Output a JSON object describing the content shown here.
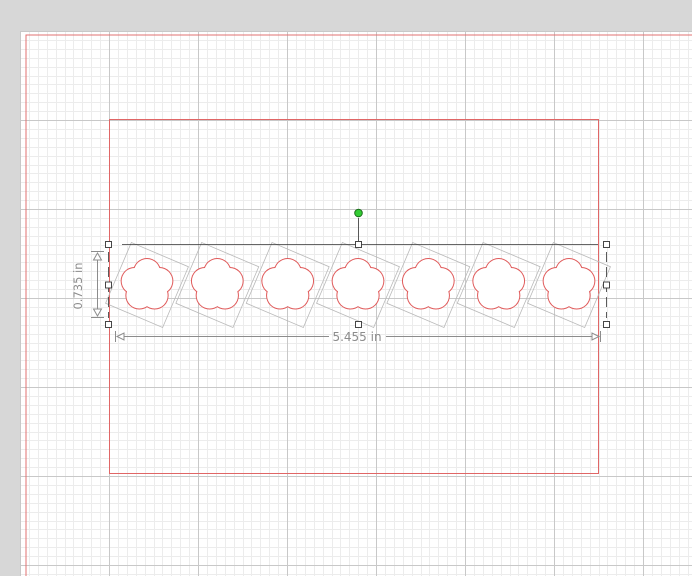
{
  "canvas": {
    "background_color": "#d7d7d7",
    "page_color": "#ffffff",
    "minor_grid_color": "#ececec",
    "major_grid_color": "#c8c8c8",
    "page_border_color": "#e07070"
  },
  "cut_area": {
    "border_color": "#e06666"
  },
  "selection": {
    "shape_count": 7,
    "shape_name": "flower",
    "shape_color": "#e05a5a",
    "bounding_box_color": "#b9b9b9",
    "handle_color": "#333333",
    "rotate_handle_color": "#33cc33",
    "width_label": "5.455 in",
    "height_label": "0.735 in",
    "dimension_color": "#8c8c8c"
  }
}
